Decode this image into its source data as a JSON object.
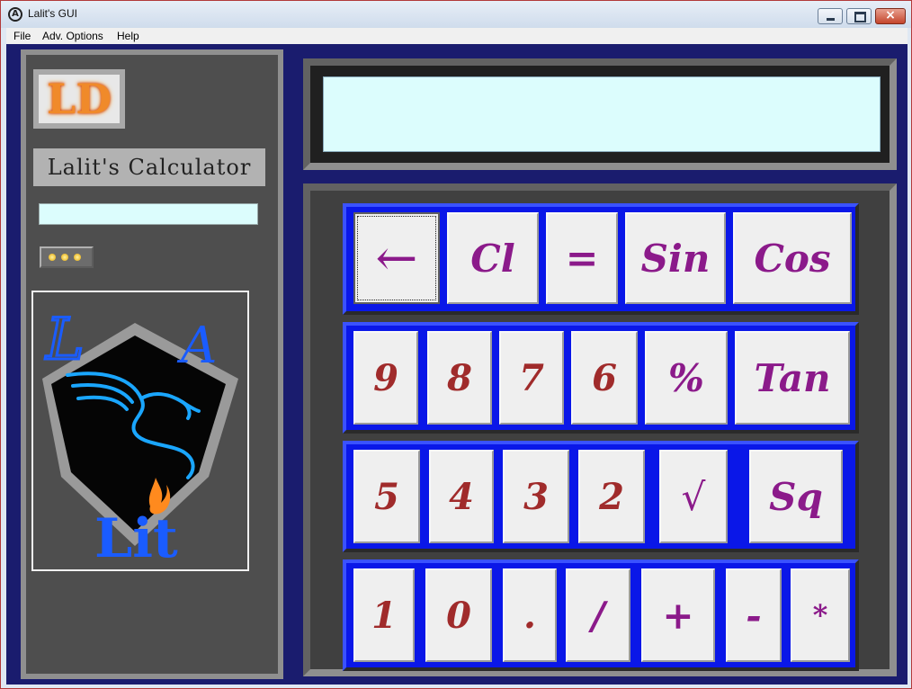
{
  "window": {
    "title": "Lalit's GUI",
    "app_icon": "avengers-icon",
    "close_glyph": "×"
  },
  "menu": {
    "items": [
      "File",
      "Adv. Options",
      "Help"
    ]
  },
  "sidebar": {
    "logo_text": "LD",
    "name_label": "Lalit's Calculator",
    "input_value": "",
    "dots_button_icon": "three-dots-icon",
    "emblem": {
      "top_letters": [
        "L",
        "A"
      ],
      "bottom_text": "Lit",
      "icons": [
        "shield-icon",
        "dragon-icon",
        "flame-icon"
      ]
    }
  },
  "display": {
    "value": ""
  },
  "keypad": {
    "rows": [
      [
        "←",
        "Cl",
        "=",
        "Sin",
        "Cos"
      ],
      [
        "9",
        "8",
        "7",
        "6",
        "%",
        "Tan"
      ],
      [
        "5",
        "4",
        "3",
        "2",
        "√",
        "Sq"
      ],
      [
        "1",
        "0",
        ".",
        "/",
        "+",
        "-",
        "*"
      ]
    ]
  },
  "colors": {
    "panel_bg": "#4e4e4e",
    "row_blue": "#0a17e8",
    "key_bg": "#efefef",
    "digit_text": "#a02b2b",
    "function_text": "#8b1a8a",
    "display_bg": "#dcfdfd",
    "emblem_blue": "#1a5cff"
  }
}
